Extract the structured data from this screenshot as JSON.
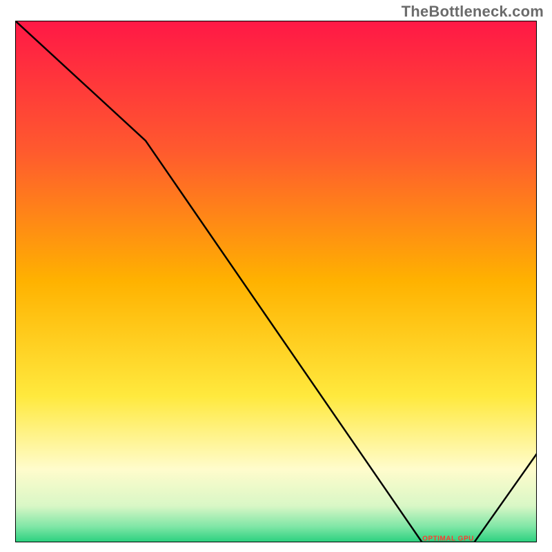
{
  "watermark": "TheBottleneck.com",
  "optimal_label": "OPTIMAL GPU",
  "chart_data": {
    "type": "line",
    "title": "",
    "xlabel": "",
    "ylabel": "",
    "xlim": [
      0,
      100
    ],
    "ylim": [
      0,
      100
    ],
    "grid": false,
    "legend": false,
    "background_gradient": {
      "stops": [
        {
          "pos": 0.0,
          "color": "#ff1846"
        },
        {
          "pos": 0.25,
          "color": "#ff5a2e"
        },
        {
          "pos": 0.5,
          "color": "#ffb200"
        },
        {
          "pos": 0.72,
          "color": "#ffe93e"
        },
        {
          "pos": 0.86,
          "color": "#fffccc"
        },
        {
          "pos": 0.93,
          "color": "#d9f7c6"
        },
        {
          "pos": 0.97,
          "color": "#7fe6a6"
        },
        {
          "pos": 1.0,
          "color": "#29d07e"
        }
      ]
    },
    "series": [
      {
        "name": "bottleneck-curve",
        "x": [
          0,
          25,
          78,
          88,
          100
        ],
        "y": [
          100,
          77,
          0,
          0,
          17
        ]
      }
    ],
    "annotations": [
      {
        "text": "OPTIMAL GPU",
        "x": 83,
        "y": 0.6,
        "color": "#ff3b30"
      }
    ],
    "axes_visible": false
  }
}
